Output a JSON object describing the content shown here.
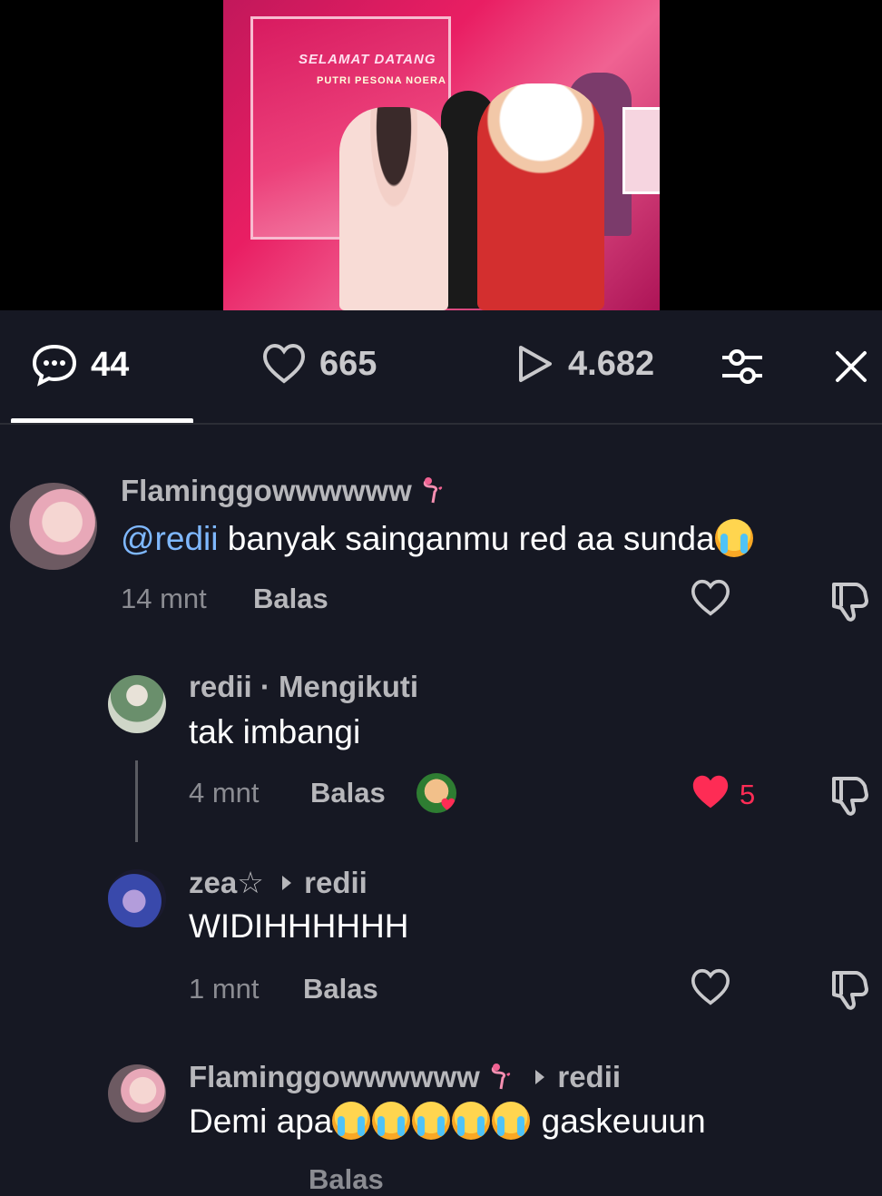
{
  "stats": {
    "comments": "44",
    "likes": "665",
    "views": "4.682"
  },
  "icons": {
    "comments": "comment-bubble-icon",
    "likes": "heart-outline-icon",
    "views": "play-icon",
    "filter": "sliders-icon",
    "close": "close-icon",
    "like": "heart-outline-icon",
    "liked": "heart-filled-icon",
    "dislike": "thumbs-down-icon",
    "reply_arrow": "caret-right-icon"
  },
  "colors": {
    "background": "#161823",
    "mention": "#7fb8ff",
    "liked": "#fe2c55",
    "muted": "#8b8c92"
  },
  "comments": [
    {
      "user": "Flaminggowwwwww",
      "mention": "@redii",
      "text": " banyak sainganmu red aa sunda",
      "time": "14 mnt",
      "reply": "Balas"
    },
    {
      "user": "redii · Mengikuti",
      "text": "tak imbangi",
      "time": "4 mnt",
      "reply": "Balas",
      "likes": "5"
    },
    {
      "user": "zea☆",
      "reply_to": "redii",
      "text": "WIDIHHHHHH",
      "time": "1 mnt",
      "reply": "Balas"
    },
    {
      "user": "Flaminggowwwwww",
      "reply_to": "redii",
      "text_a": "Demi apa",
      "text_b": " gaskeuuun",
      "time": "",
      "reply": "Balas"
    }
  ]
}
